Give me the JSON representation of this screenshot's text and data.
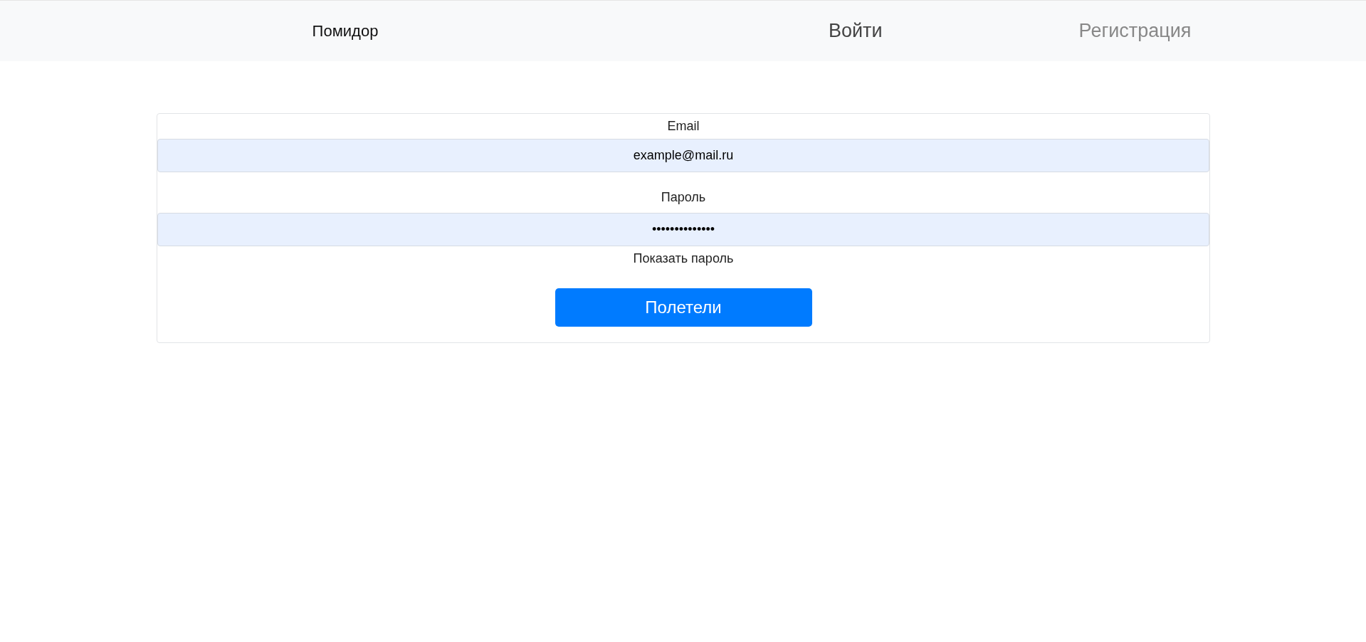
{
  "navbar": {
    "brand": "Помидор",
    "links": [
      {
        "label": "Войти",
        "selected": true
      },
      {
        "label": "Регистрация",
        "selected": false
      }
    ]
  },
  "form": {
    "fields": [
      {
        "label": "Email",
        "value": "example@mail.ru"
      },
      {
        "label": "Пароль",
        "value": "••••••••••••••"
      }
    ],
    "show_password": {
      "label": "Показать пароль"
    },
    "submit": "Полетели"
  }
}
